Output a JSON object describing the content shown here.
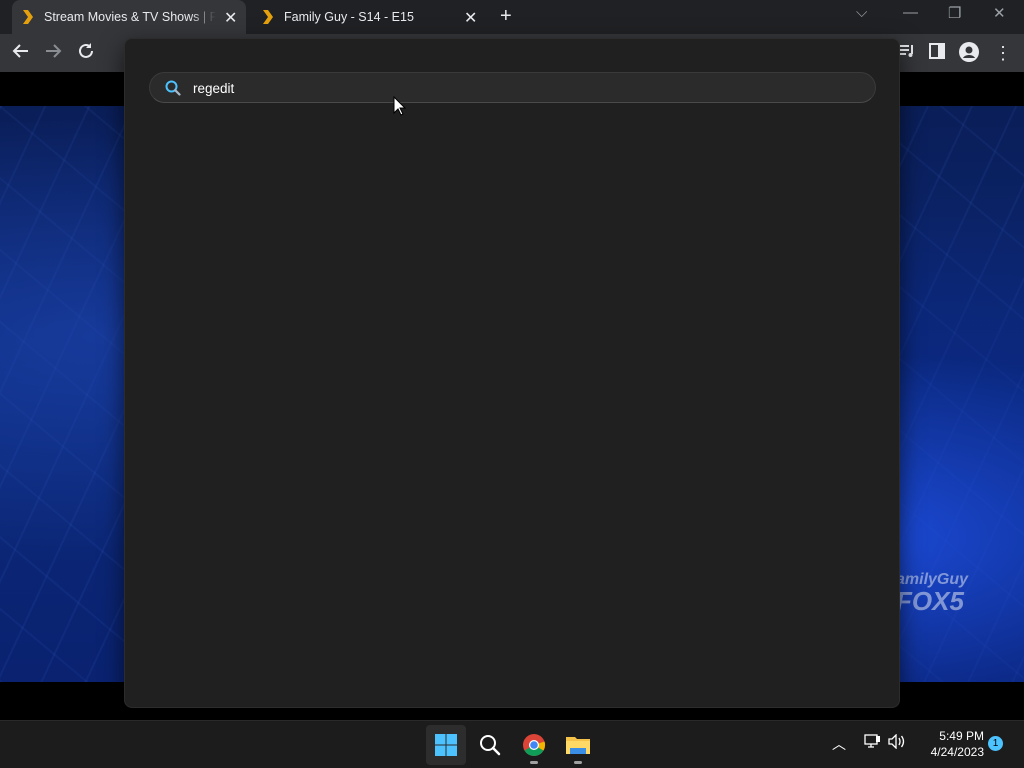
{
  "browser": {
    "tabs": [
      {
        "title": "Stream Movies & TV Shows | Plex",
        "active": true
      },
      {
        "title": "Family Guy - S14 - E15",
        "active": false
      }
    ],
    "new_tab_icon": "plus-icon",
    "window_controls": [
      "chevron-down-icon",
      "minimize-icon",
      "restore-icon",
      "close-icon"
    ],
    "toolbar_icons": [
      "back-arrow-icon",
      "forward-arrow-icon",
      "reload-icon",
      "media-icon",
      "sidepanel-icon",
      "profile-icon",
      "menu-icon"
    ]
  },
  "video": {
    "logo_line1": "amilyGuy",
    "logo_line2": "FOX5"
  },
  "search": {
    "query": "regedit",
    "icon": "search-icon"
  },
  "taskbar": {
    "apps": [
      {
        "name": "start",
        "icon": "windows-logo-icon"
      },
      {
        "name": "search",
        "icon": "search-icon"
      },
      {
        "name": "chrome",
        "icon": "chrome-icon",
        "running": true
      },
      {
        "name": "file-explorer",
        "icon": "folder-icon",
        "running": true
      }
    ],
    "tray": {
      "time": "5:49 PM",
      "date": "4/24/2023",
      "notification_count": "1"
    }
  },
  "colors": {
    "accent": "#4cc2ff",
    "flyout_bg": "#202020",
    "tab_bar": "#202124",
    "toolbar": "#35363a"
  }
}
